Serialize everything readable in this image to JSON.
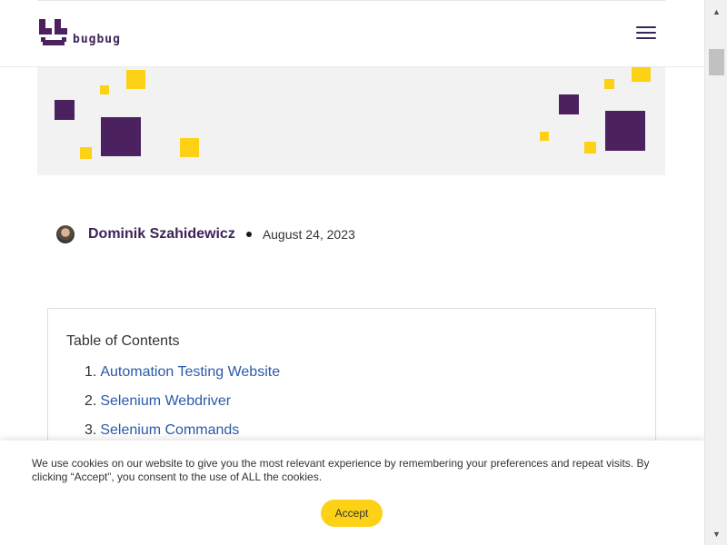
{
  "header": {
    "logo_text": "bugbug",
    "menu_icon": "hamburger-menu-icon",
    "brand_color": "#3d2457"
  },
  "hero": {
    "accent_purple": "#4b2160",
    "accent_yellow": "#fcd116"
  },
  "author": {
    "name": "Dominik Szahidewicz",
    "date": "August 24, 2023"
  },
  "toc": {
    "title": "Table of Contents",
    "items": [
      {
        "num": "1.",
        "label": "Automation Testing Website"
      },
      {
        "num": "2.",
        "label": "Selenium Webdriver"
      },
      {
        "num": "3.",
        "label": "Selenium Commands"
      }
    ]
  },
  "cookie": {
    "text": "We use cookies on our website to give you the most relevant experience by remembering your preferences and repeat visits. By clicking “Accept”, you consent to the use of ALL the cookies.",
    "accept_label": "Accept"
  },
  "scrollbar": {
    "up_icon": "scroll-up-arrow-icon",
    "down_icon": "scroll-down-arrow-icon"
  }
}
